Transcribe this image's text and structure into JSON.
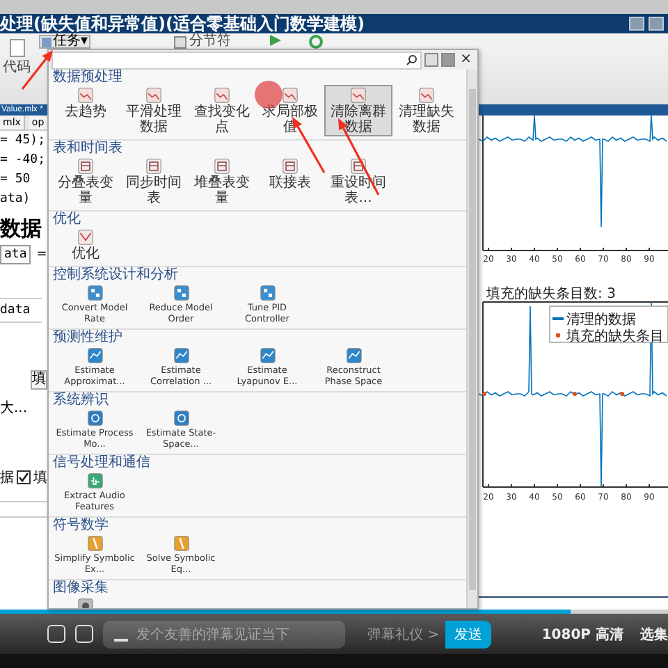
{
  "video_title": "处理(缺失值和异常值)(适合零基础入门数学建模)",
  "toolbar": {
    "code_label": "代码",
    "task_button": "任务",
    "dropdown_glyph": "▾",
    "section_break": "分节符"
  },
  "editor": {
    "file_tab": "Value.mlx *",
    "tabs": [
      "mlx",
      "op"
    ],
    "code_lines": [
      "= 45);",
      "= -40;",
      "= 50",
      "ata)"
    ],
    "heading": "数据",
    "field_value": "ata",
    "operator": "=",
    "data_field": "data",
    "fill_button": "填",
    "truncated_label": "大...",
    "row_label": "据",
    "checkbox": {
      "label": "填",
      "checked": true
    }
  },
  "gallery": {
    "close_glyph": "×",
    "sections": [
      {
        "title": "数据预处理",
        "kind": "chart",
        "items": [
          {
            "label": "去趋势",
            "selected": false
          },
          {
            "label": "平滑处理数据",
            "selected": false
          },
          {
            "label": "查找变化点",
            "selected": false
          },
          {
            "label": "求局部极值",
            "selected": false
          },
          {
            "label": "清除离群数据",
            "selected": true
          },
          {
            "label": "清理缺失数据",
            "selected": false
          }
        ]
      },
      {
        "title": "表和时间表",
        "kind": "table",
        "items": [
          {
            "label": "分叠表变量",
            "selected": false
          },
          {
            "label": "同步时间表",
            "selected": false
          },
          {
            "label": "堆叠表变量",
            "selected": false
          },
          {
            "label": "联接表",
            "selected": false
          },
          {
            "label": "重设时间表...",
            "selected": false
          }
        ]
      },
      {
        "title": "优化",
        "kind": "optim",
        "items": [
          {
            "label": "优化",
            "selected": false
          }
        ]
      },
      {
        "title": "控制系统设计和分析",
        "kind": "control",
        "items": [
          {
            "label": "Convert Model Rate",
            "selected": false
          },
          {
            "label": "Reduce Model Order",
            "selected": false
          },
          {
            "label": "Tune PID Controller",
            "selected": false
          }
        ]
      },
      {
        "title": "预测性维护",
        "kind": "maintenance",
        "items": [
          {
            "label": "Estimate Approximat...",
            "selected": false
          },
          {
            "label": "Estimate Correlation ...",
            "selected": false
          },
          {
            "label": "Estimate Lyapunov E...",
            "selected": false
          },
          {
            "label": "Reconstruct Phase Space",
            "selected": false
          }
        ]
      },
      {
        "title": "系统辨识",
        "kind": "sysid",
        "items": [
          {
            "label": "Estimate Process Mo...",
            "selected": false
          },
          {
            "label": "Estimate State-Space...",
            "selected": false
          }
        ]
      },
      {
        "title": "信号处理和通信",
        "kind": "audio",
        "items": [
          {
            "label": "Extract Audio Features",
            "selected": false
          }
        ]
      },
      {
        "title": "符号数学",
        "kind": "symbolic",
        "items": [
          {
            "label": "Simplify Symbolic Ex...",
            "selected": false
          },
          {
            "label": "Solve Symbolic Eq...",
            "selected": false
          }
        ]
      },
      {
        "title": "图像采集",
        "kind": "camera",
        "items": [
          {
            "selected": false
          }
        ]
      }
    ]
  },
  "figure": {
    "top_xticks": [
      "20",
      "30",
      "40",
      "50",
      "60",
      "70",
      "80",
      "90"
    ],
    "bottom_title": "填充的缺失条目数: 3",
    "legend": [
      {
        "label": "清理的数据",
        "kind": "line",
        "color": "#0072bd"
      },
      {
        "label": "填充的缺失条目",
        "kind": "marker",
        "color": "#d95319"
      }
    ],
    "bottom_xticks": [
      "20",
      "30",
      "40",
      "50",
      "60",
      "70",
      "80",
      "90"
    ]
  },
  "player": {
    "progress": {
      "level": 0.855
    },
    "danmaku_placeholder": "发个友善的弹幕见证当下",
    "etiquette": "弹幕礼仪 >",
    "send": "发送",
    "quality": "1080P 高清",
    "episodes": "选集"
  }
}
